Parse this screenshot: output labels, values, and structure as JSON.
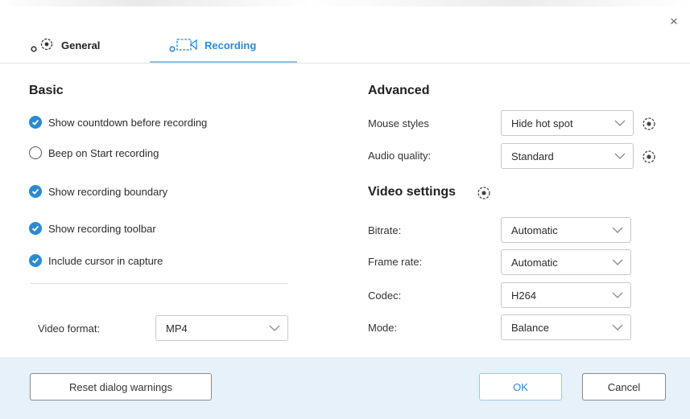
{
  "dialog": {
    "close_symbol": "×"
  },
  "tabs": [
    {
      "label": "General",
      "icon": "gear-icon"
    },
    {
      "label": "Recording",
      "icon": "camera-icon"
    }
  ],
  "basic": {
    "heading": "Basic",
    "options": [
      {
        "label": "Show countdown before recording",
        "checked": true
      },
      {
        "label": "Beep on Start recording",
        "checked": false
      },
      {
        "label": "Show recording boundary",
        "checked": true
      },
      {
        "label": "Show recording toolbar",
        "checked": true
      },
      {
        "label": "Include cursor in capture",
        "checked": true
      }
    ],
    "video_format": {
      "label": "Video format:",
      "value": "MP4"
    }
  },
  "advanced": {
    "heading": "Advanced",
    "mouse_styles": {
      "label": "Mouse styles",
      "value": "Hide hot spot"
    },
    "audio_quality": {
      "label": "Audio quality:",
      "value": "Standard"
    }
  },
  "video_settings": {
    "heading": "Video settings",
    "bitrate": {
      "label": "Bitrate:",
      "value": "Automatic"
    },
    "frame_rate": {
      "label": "Frame rate:",
      "value": "Automatic"
    },
    "codec": {
      "label": "Codec:",
      "value": "H264"
    },
    "mode": {
      "label": "Mode:",
      "value": "Balance"
    }
  },
  "footer": {
    "reset_label": "Reset dialog warnings",
    "ok_label": "OK",
    "cancel_label": "Cancel"
  },
  "colors": {
    "accent": "#2a8bd1",
    "footer_bg": "#e6f1fa"
  }
}
